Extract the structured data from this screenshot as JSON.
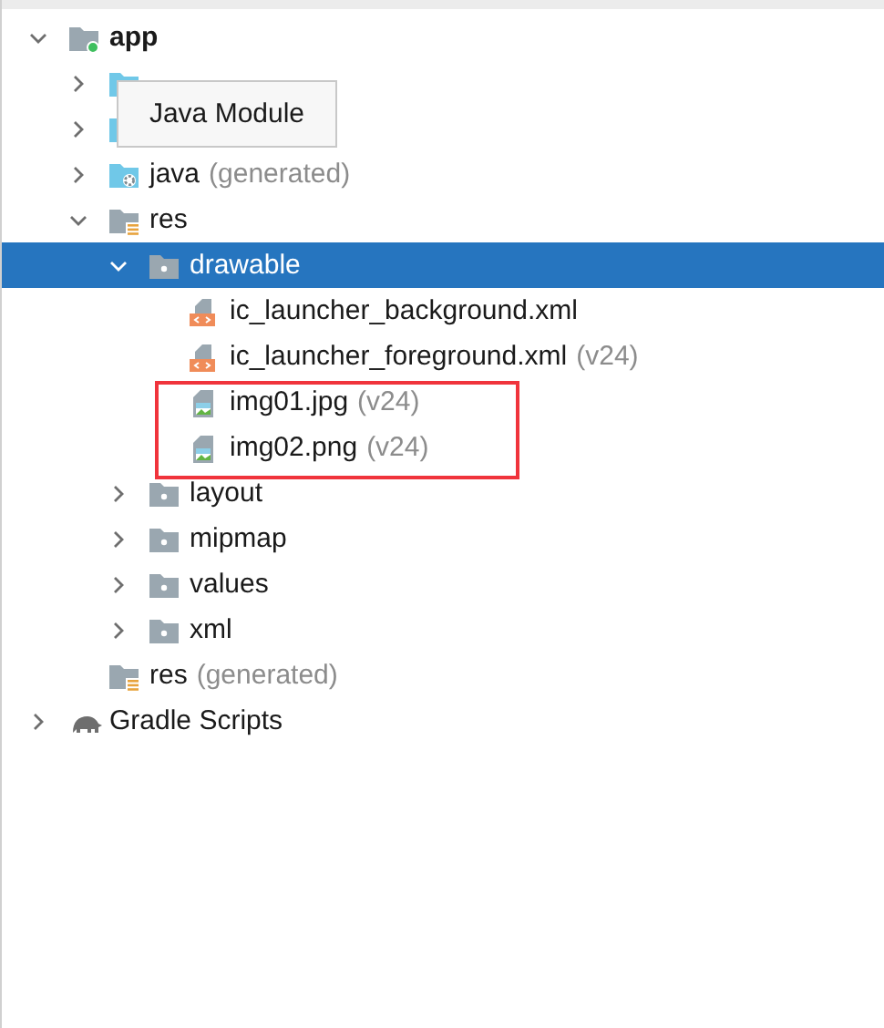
{
  "tree": [
    {
      "label": "app",
      "kind": "module",
      "bold": true,
      "expanded": true,
      "selected": false,
      "children": [
        {
          "kind": "source-folder",
          "expanded": false,
          "selected": false
        },
        {
          "kind": "source-folder",
          "expanded": false,
          "selected": false
        },
        {
          "label": "java",
          "suffix": "(generated)",
          "kind": "generated-folder",
          "expanded": false,
          "selected": false
        },
        {
          "label": "res",
          "kind": "resource-root",
          "expanded": true,
          "selected": false,
          "children": [
            {
              "label": "drawable",
              "kind": "resource-folder",
              "expanded": true,
              "selected": true,
              "children": [
                {
                  "label": "ic_launcher_background.xml",
                  "kind": "xml-file",
                  "selected": false,
                  "highlighted": false
                },
                {
                  "label": "ic_launcher_foreground.xml",
                  "suffix": "(v24)",
                  "kind": "xml-file",
                  "selected": false,
                  "highlighted": false
                },
                {
                  "label": "img01.jpg",
                  "suffix": "(v24)",
                  "kind": "image-file",
                  "selected": false,
                  "highlighted": true
                },
                {
                  "label": "img02.png",
                  "suffix": "(v24)",
                  "kind": "image-file",
                  "selected": false,
                  "highlighted": true
                }
              ]
            },
            {
              "label": "layout",
              "kind": "resource-folder",
              "expanded": false,
              "selected": false
            },
            {
              "label": "mipmap",
              "kind": "resource-folder",
              "expanded": false,
              "selected": false
            },
            {
              "label": "values",
              "kind": "resource-folder",
              "expanded": false,
              "selected": false
            },
            {
              "label": "xml",
              "kind": "resource-folder",
              "expanded": false,
              "selected": false
            }
          ]
        },
        {
          "label": "res",
          "suffix": "(generated)",
          "kind": "resource-root",
          "selected": false
        }
      ]
    },
    {
      "label": "Gradle Scripts",
      "kind": "gradle",
      "expanded": false,
      "selected": false
    }
  ],
  "tooltip": {
    "text": "Java Module"
  }
}
